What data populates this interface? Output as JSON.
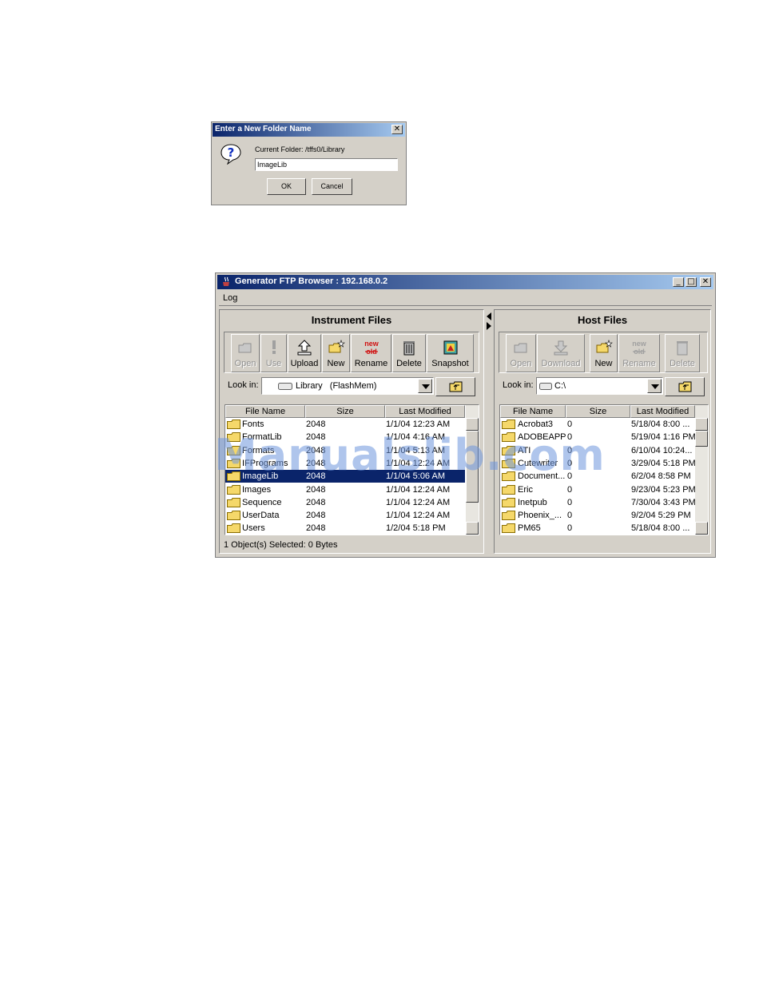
{
  "dialog": {
    "title": "Enter a New Folder Name",
    "close_glyph": "✕",
    "icon": "question-icon",
    "current_folder_label": "Current Folder: /tffs0/Library",
    "folder_name_value": "ImageLib",
    "ok_label": "OK",
    "cancel_label": "Cancel"
  },
  "window": {
    "title": "Generator FTP Browser : 192.168.0.2",
    "minimize_glyph": "_",
    "maximize_glyph": "□",
    "close_glyph": "✕",
    "menu": [
      "Log"
    ]
  },
  "instrument": {
    "title": "Instrument Files",
    "toolbar": [
      {
        "label": "Open",
        "icon": "open-folder-icon",
        "enabled": false
      },
      {
        "label": "Use",
        "icon": "exclamation-icon",
        "enabled": false
      },
      {
        "label": "Upload",
        "icon": "upload-icon",
        "enabled": true
      },
      {
        "label": "New",
        "icon": "new-folder-icon",
        "enabled": true
      },
      {
        "label": "Rename",
        "icon": "rename-icon",
        "enabled": true
      },
      {
        "label": "Delete",
        "icon": "trash-icon",
        "enabled": true
      },
      {
        "label": "Snapshot",
        "icon": "snapshot-icon",
        "enabled": true
      }
    ],
    "look_in_label": "Look in:",
    "look_in_value": "Library   (FlashMem)",
    "columns": [
      "File Name",
      "Size",
      "Last Modified"
    ],
    "rows": [
      {
        "name": "Fonts",
        "size": "2048",
        "modified": "1/1/04 12:23 AM",
        "selected": false
      },
      {
        "name": "FormatLib",
        "size": "2048",
        "modified": "1/1/04 4:16 AM",
        "selected": false
      },
      {
        "name": "Formats",
        "size": "2048",
        "modified": "1/1/04 5:13 AM",
        "selected": false
      },
      {
        "name": "IFPrograms",
        "size": "2048",
        "modified": "1/1/04 12:24 AM",
        "selected": false
      },
      {
        "name": "ImageLib",
        "size": "2048",
        "modified": "1/1/04 5:06 AM",
        "selected": true
      },
      {
        "name": "Images",
        "size": "2048",
        "modified": "1/1/04 12:24 AM",
        "selected": false
      },
      {
        "name": "Sequence",
        "size": "2048",
        "modified": "1/1/04 12:24 AM",
        "selected": false
      },
      {
        "name": "UserData",
        "size": "2048",
        "modified": "1/1/04 12:24 AM",
        "selected": false
      },
      {
        "name": "Users",
        "size": "2048",
        "modified": "1/2/04 5:18 PM",
        "selected": false
      }
    ],
    "status": "1 Object(s) Selected:  0 Bytes"
  },
  "host": {
    "title": "Host Files",
    "toolbar": [
      {
        "label": "Open",
        "icon": "open-folder-icon",
        "enabled": false
      },
      {
        "label": "Download",
        "icon": "download-icon",
        "enabled": false
      },
      {
        "label": "New",
        "icon": "new-folder-icon",
        "enabled": true
      },
      {
        "label": "Rename",
        "icon": "rename-icon",
        "enabled": false
      },
      {
        "label": "Delete",
        "icon": "trash-icon",
        "enabled": false
      }
    ],
    "look_in_label": "Look in:",
    "look_in_value": "C:\\",
    "columns": [
      "File Name",
      "Size",
      "Last Modified"
    ],
    "rows": [
      {
        "name": "Acrobat3",
        "size": "0",
        "modified": "5/18/04 8:00 ..."
      },
      {
        "name": "ADOBEAPP",
        "size": "0",
        "modified": "5/19/04 1:16 PM"
      },
      {
        "name": "ATI",
        "size": "0",
        "modified": "6/10/04 10:24..."
      },
      {
        "name": "Cutewriter",
        "size": "0",
        "modified": "3/29/04 5:18 PM"
      },
      {
        "name": "Document...",
        "size": "0",
        "modified": "6/2/04 8:58 PM"
      },
      {
        "name": "Eric",
        "size": "0",
        "modified": "9/23/04 5:23 PM"
      },
      {
        "name": "Inetpub",
        "size": "0",
        "modified": "7/30/04 3:43 PM"
      },
      {
        "name": "Phoenix_...",
        "size": "0",
        "modified": "9/2/04 5:29 PM"
      },
      {
        "name": "PM65",
        "size": "0",
        "modified": "5/18/04 8:00 ..."
      }
    ]
  },
  "watermark": "Manualslib.com",
  "colors": {
    "title_start": "#0a246a",
    "title_end": "#a6caf0",
    "face": "#d4d0c8",
    "selection": "#0a246a",
    "folder": "#f5d86a"
  }
}
